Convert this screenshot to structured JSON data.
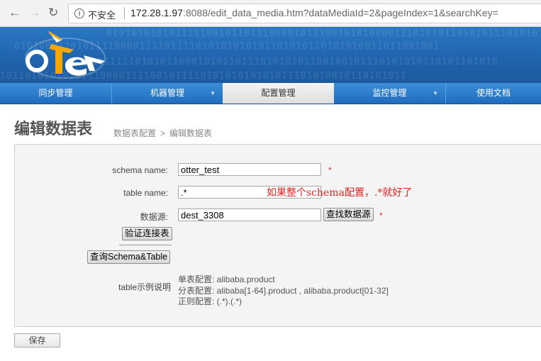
{
  "browser": {
    "insecure_label": "不安全",
    "url_host": "172.28.1.97",
    "url_rest": ":8088/edit_data_media.htm?dataMediaId=2&pageIndex=1&searchKey="
  },
  "banner": {
    "binary_rows": [
      "0101010101011111001011011100001011100101010000111010101101010111010101",
      "01010001101011110000111101111010101010101101010110101010011011001001",
      "000111110101011000101011011101010101100100101110101010110101101010",
      "10110101010101110000111100101111010101010101011101010010110101011"
    ]
  },
  "menu": {
    "items": [
      {
        "label": "同步管理"
      },
      {
        "label": "机器管理",
        "has_dropdown": true
      },
      {
        "label": "配置管理",
        "active": true
      },
      {
        "label": "监控管理",
        "has_dropdown": true
      },
      {
        "label": "使用文档"
      }
    ]
  },
  "page": {
    "title": "编辑数据表",
    "breadcrumb_parent": "数据表配置",
    "breadcrumb_separator": ">",
    "breadcrumb_current": "编辑数据表"
  },
  "form": {
    "schema_label": "schema name:",
    "schema_value": "otter_test",
    "table_label": "table name:",
    "table_value": ".*",
    "annotation": "如果整个schema配置，.*就好了",
    "source_label": "数据源:",
    "source_value": "dest_3308",
    "find_source_button": "查找数据源",
    "verify_button": "验证连接表",
    "query_button": "查询Schema&Table",
    "required_mark": "*",
    "examples_label": "table示例说明",
    "examples": [
      "单表配置: alibaba.product",
      "分表配置: alibaba[1-64].product , alibaba.product[01-32]",
      "正则配置: (.*).(.*)"
    ],
    "save_button": "保存"
  }
}
